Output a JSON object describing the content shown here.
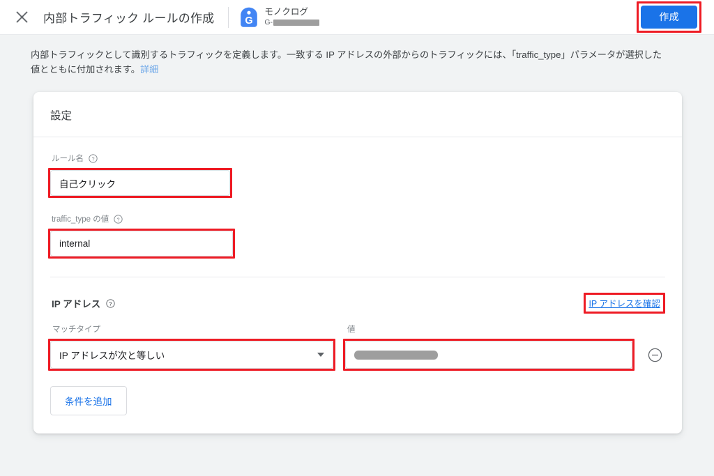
{
  "topbar": {
    "close_icon": "close-icon",
    "title": "内部トラフィック ルールの作成",
    "property": {
      "tag_icon": "google-tag-icon",
      "name": "モノクログ",
      "id_prefix": "G-"
    },
    "create_label": "作成"
  },
  "description": {
    "text_before_link": "内部トラフィックとして識別するトラフィックを定義します。一致する IP アドレスの外部からのトラフィックには、「traffic_type」パラメータが選択した値とともに付加されます。",
    "link_label": "詳細"
  },
  "card": {
    "header": "設定",
    "rule_name": {
      "label": "ルール名",
      "help_icon": "help-circle-icon",
      "value": "自己クリック",
      "placeholder": "ルール名"
    },
    "traffic_type": {
      "label": "traffic_type の値",
      "help_icon": "help-circle-icon",
      "value": "internal",
      "placeholder": "internal"
    },
    "ip_section": {
      "title": "IP アドレス",
      "help_icon": "help-circle-icon",
      "check_link": "IP アドレスを確認",
      "match_type": {
        "label": "マッチタイプ",
        "selected": "IP アドレスが次と等しい",
        "caret_icon": "chevron-down-icon"
      },
      "value_field": {
        "label": "値",
        "value": "",
        "redacted": true
      },
      "remove_icon": "remove-circle-icon",
      "add_condition_label": "条件を追加"
    }
  },
  "colors": {
    "accent_blue": "#1a73e8",
    "annotation_red": "#ee1b24",
    "page_background": "#f1f3f4",
    "link_light_blue": "#6fa8e8"
  }
}
